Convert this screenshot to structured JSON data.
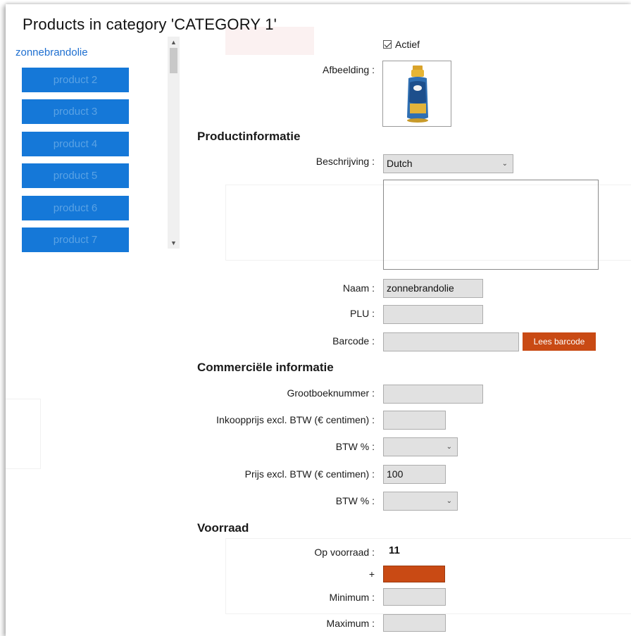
{
  "page": {
    "title": "Products in category 'CATEGORY 1'"
  },
  "product_list": {
    "selected": "zonnebrandolie",
    "items": [
      "product 2",
      "product 3",
      "product 4",
      "product 5",
      "product 6",
      "product 7"
    ]
  },
  "form": {
    "active_label": "Actief",
    "active_checked": true,
    "image_label": "Afbeelding :",
    "section_product": "Productinformatie",
    "description_label": "Beschrijving :",
    "description_language": "Dutch",
    "description_text": "",
    "name_label": "Naam :",
    "name_value": "zonnebrandolie",
    "plu_label": "PLU :",
    "plu_value": "",
    "barcode_label": "Barcode :",
    "barcode_value": "",
    "read_barcode_button": "Lees barcode",
    "section_commercial": "Commerciële informatie",
    "ledger_label": "Grootboeknummer :",
    "ledger_value": "",
    "purchase_price_label": "Inkoopprijs excl. BTW (€ centimen) :",
    "purchase_price_value": "",
    "vat1_label": "BTW % :",
    "vat1_value": "",
    "price_label": "Prijs excl. BTW (€ centimen) :",
    "price_value": "100",
    "vat2_label": "BTW % :",
    "vat2_value": "",
    "section_stock": "Voorraad",
    "in_stock_label": "Op voorraad :",
    "in_stock_value": "11",
    "add_label": "+",
    "minimum_label": "Minimum :",
    "minimum_value": "",
    "maximum_label": "Maximum :",
    "maximum_value": ""
  },
  "colors": {
    "product_button": "#1578d8",
    "accent_red": "#c94a14",
    "selected_link": "#1e6fd0"
  }
}
